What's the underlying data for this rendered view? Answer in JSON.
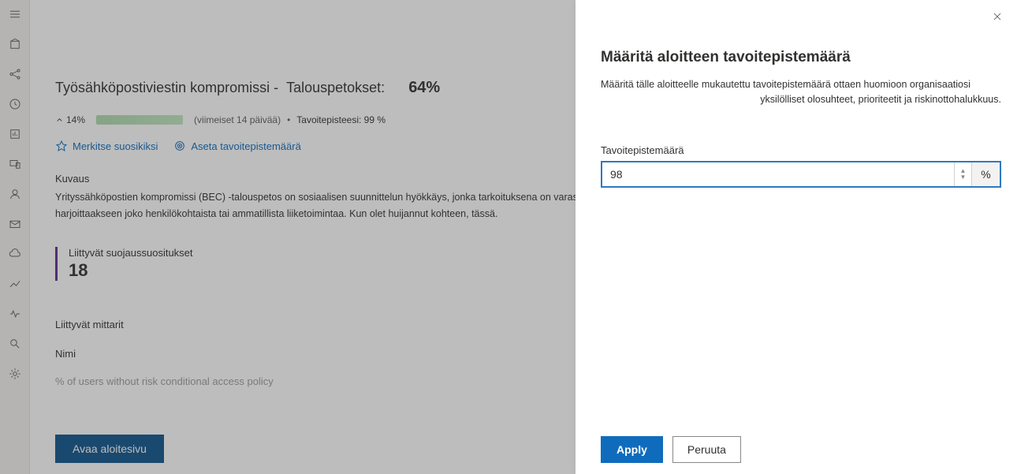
{
  "nav": {
    "items": [
      "menu",
      "package",
      "share",
      "clock",
      "reports",
      "devices",
      "users",
      "mail",
      "cloud",
      "analytics",
      "health",
      "search",
      "settings"
    ]
  },
  "main": {
    "title_prefix": "Työsähköpostiviestin kompromissi -",
    "title_suffix": "Talouspetokset:",
    "title_pct": "64%",
    "trend_pct": "14%",
    "trend_period": "(viimeiset 14 päivää)",
    "separator": "•",
    "target_label": "Tavoitepisteesi: 99 %",
    "favorite_action": "Merkitse suosikiksi",
    "set_target_action": "Aseta tavoitepistemäärä",
    "desc_label": "Kuvaus",
    "desc_text": "Yrityssähköpostien kompromissi (BEC) -talouspetos on sosiaalisen suunnittelun hyökkäys, jonka tarkoituksena on varastaa rahaa luotetun tahon kanssa harjoittaakseen joko henkilökohtaista tai ammatillista liiketoimintaa. Kun olet huijannut kohteen, tässä.",
    "related_label": "Liittyvät suojaussuositukset",
    "related_count": "18",
    "metrics_label": "Liittyvät mittarit",
    "col_name": "Nimi",
    "cut_row": "% of users without risk conditional access policy",
    "open_page_btn": "Avaa aloitesivu"
  },
  "panel": {
    "title": "Määritä aloitteen tavoitepistemäärä",
    "desc_line1": "Määritä tälle aloitteelle mukautettu tavoitepistemäärä ottaen huomioon organisaatiosi",
    "desc_line2": ".yksilölliset olosuhteet, prioriteetit ja riskinottohalukkuus",
    "field_label": "Tavoitepistemäärä",
    "value": "98",
    "suffix": "%",
    "apply": "Apply",
    "cancel": "Peruuta"
  }
}
